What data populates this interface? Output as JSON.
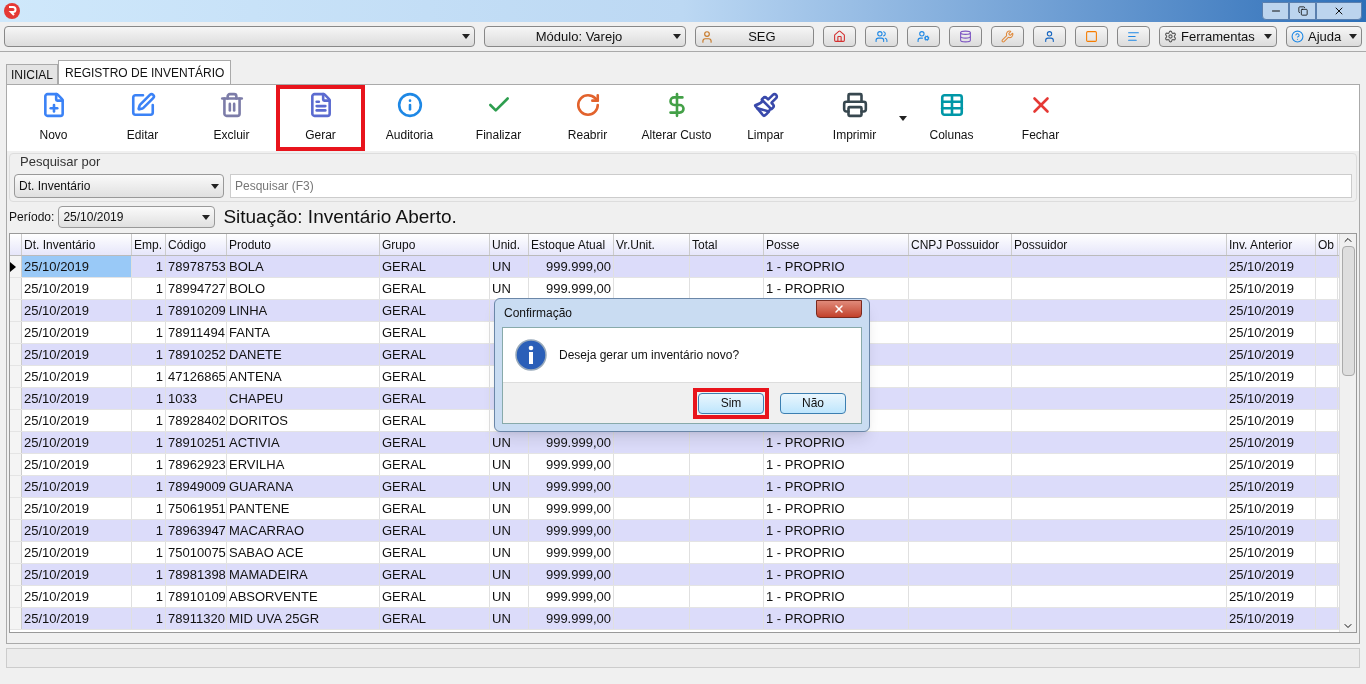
{
  "top_bar": {
    "module_combo": "Módulo: Varejo",
    "user_button": "SEG",
    "tools_menu": "Ferramentas",
    "help_menu": "Ajuda"
  },
  "tabs": [
    {
      "label": "INICIAL",
      "selected": false
    },
    {
      "label": "REGISTRO DE INVENTÁRIO",
      "selected": true
    }
  ],
  "toolbar": [
    {
      "label": "Novo",
      "highlighted": false
    },
    {
      "label": "Editar",
      "highlighted": false
    },
    {
      "label": "Excluir",
      "highlighted": false
    },
    {
      "label": "Gerar",
      "highlighted": true
    },
    {
      "label": "Auditoria",
      "highlighted": false
    },
    {
      "label": "Finalizar",
      "highlighted": false
    },
    {
      "label": "Reabrir",
      "highlighted": false
    },
    {
      "label": "Alterar Custo",
      "highlighted": false
    },
    {
      "label": "Limpar",
      "highlighted": false
    },
    {
      "label": "Imprimir",
      "highlighted": false
    },
    {
      "label": "Colunas",
      "highlighted": false
    },
    {
      "label": "Fechar",
      "highlighted": false
    }
  ],
  "search": {
    "group_label": "Pesquisar por",
    "field_combo": "Dt. Inventário",
    "placeholder": "Pesquisar (F3)"
  },
  "period": {
    "label": "Período:",
    "value": "25/10/2019"
  },
  "status": "Situação: Inventário Aberto.",
  "table": {
    "columns": [
      "Dt. Inventário",
      "Emp.",
      "Código",
      "Produto",
      "Grupo",
      "Unid.",
      "Estoque Atual",
      "Vr.Unit.",
      "Total",
      "Posse",
      "CNPJ Possuidor",
      "Possuidor",
      "Inv. Anterior",
      "Ob"
    ],
    "rows": [
      {
        "selected": true,
        "dt": "25/10/2019",
        "emp": "1",
        "codigo": "78978753",
        "produto": "BOLA",
        "grupo": "GERAL",
        "unid": "UN",
        "estoque": "999.999,00",
        "posse": "1 - PROPRIO",
        "inv_anterior": "25/10/2019"
      },
      {
        "selected": false,
        "dt": "25/10/2019",
        "emp": "1",
        "codigo": "78994727",
        "produto": "BOLO",
        "grupo": "GERAL",
        "unid": "UN",
        "estoque": "999.999,00",
        "posse": "1 - PROPRIO",
        "inv_anterior": "25/10/2019"
      },
      {
        "selected": false,
        "dt": "25/10/2019",
        "emp": "1",
        "codigo": "78910209",
        "produto": "LINHA",
        "grupo": "GERAL",
        "inv_anterior": "25/10/2019"
      },
      {
        "selected": false,
        "dt": "25/10/2019",
        "emp": "1",
        "codigo": "78911494",
        "produto": "FANTA",
        "grupo": "GERAL",
        "inv_anterior": "25/10/2019"
      },
      {
        "selected": false,
        "dt": "25/10/2019",
        "emp": "1",
        "codigo": "78910252",
        "produto": "DANETE",
        "grupo": "GERAL",
        "inv_anterior": "25/10/2019"
      },
      {
        "selected": false,
        "dt": "25/10/2019",
        "emp": "1",
        "codigo": "47126865",
        "produto": "ANTENA",
        "grupo": "GERAL",
        "inv_anterior": "25/10/2019"
      },
      {
        "selected": false,
        "dt": "25/10/2019",
        "emp": "1",
        "codigo": "1033",
        "produto": "CHAPEU",
        "grupo": "GERAL",
        "inv_anterior": "25/10/2019"
      },
      {
        "selected": false,
        "dt": "25/10/2019",
        "emp": "1",
        "codigo": "78928402",
        "produto": "DORITOS",
        "grupo": "GERAL",
        "inv_anterior": "25/10/2019"
      },
      {
        "selected": false,
        "dt": "25/10/2019",
        "emp": "1",
        "codigo": "78910251",
        "produto": "ACTIVIA",
        "grupo": "GERAL",
        "unid": "UN",
        "estoque": "999.999,00",
        "posse": "1 - PROPRIO",
        "inv_anterior": "25/10/2019"
      },
      {
        "selected": false,
        "dt": "25/10/2019",
        "emp": "1",
        "codigo": "78962923",
        "produto": "ERVILHA",
        "grupo": "GERAL",
        "unid": "UN",
        "estoque": "999.999,00",
        "posse": "1 - PROPRIO",
        "inv_anterior": "25/10/2019"
      },
      {
        "selected": false,
        "dt": "25/10/2019",
        "emp": "1",
        "codigo": "78949009",
        "produto": "GUARANA",
        "grupo": "GERAL",
        "unid": "UN",
        "estoque": "999.999,00",
        "posse": "1 - PROPRIO",
        "inv_anterior": "25/10/2019"
      },
      {
        "selected": false,
        "dt": "25/10/2019",
        "emp": "1",
        "codigo": "75061951",
        "produto": "PANTENE",
        "grupo": "GERAL",
        "unid": "UN",
        "estoque": "999.999,00",
        "posse": "1 - PROPRIO",
        "inv_anterior": "25/10/2019"
      },
      {
        "selected": false,
        "dt": "25/10/2019",
        "emp": "1",
        "codigo": "78963947",
        "produto": "MACARRAO",
        "grupo": "GERAL",
        "unid": "UN",
        "estoque": "999.999,00",
        "posse": "1 - PROPRIO",
        "inv_anterior": "25/10/2019"
      },
      {
        "selected": false,
        "dt": "25/10/2019",
        "emp": "1",
        "codigo": "75010075",
        "produto": "SABAO ACE",
        "grupo": "GERAL",
        "unid": "UN",
        "estoque": "999.999,00",
        "posse": "1 - PROPRIO",
        "inv_anterior": "25/10/2019"
      },
      {
        "selected": false,
        "dt": "25/10/2019",
        "emp": "1",
        "codigo": "78981398",
        "produto": "MAMADEIRA",
        "grupo": "GERAL",
        "unid": "UN",
        "estoque": "999.999,00",
        "posse": "1 - PROPRIO",
        "inv_anterior": "25/10/2019"
      },
      {
        "selected": false,
        "dt": "25/10/2019",
        "emp": "1",
        "codigo": "78910109",
        "produto": "ABSORVENTE",
        "grupo": "GERAL",
        "unid": "UN",
        "estoque": "999.999,00",
        "posse": "1 - PROPRIO",
        "inv_anterior": "25/10/2019"
      },
      {
        "selected": false,
        "dt": "25/10/2019",
        "emp": "1",
        "codigo": "78911320",
        "produto": "MID UVA 25GR",
        "grupo": "GERAL",
        "unid": "UN",
        "estoque": "999.999,00",
        "posse": "1 - PROPRIO",
        "inv_anterior": "25/10/2019"
      }
    ]
  },
  "dialog": {
    "title": "Confirmação",
    "message": "Deseja gerar um inventário novo?",
    "buttons": [
      {
        "label": "Sim",
        "highlighted": true
      },
      {
        "label": "Não",
        "highlighted": false
      }
    ]
  }
}
